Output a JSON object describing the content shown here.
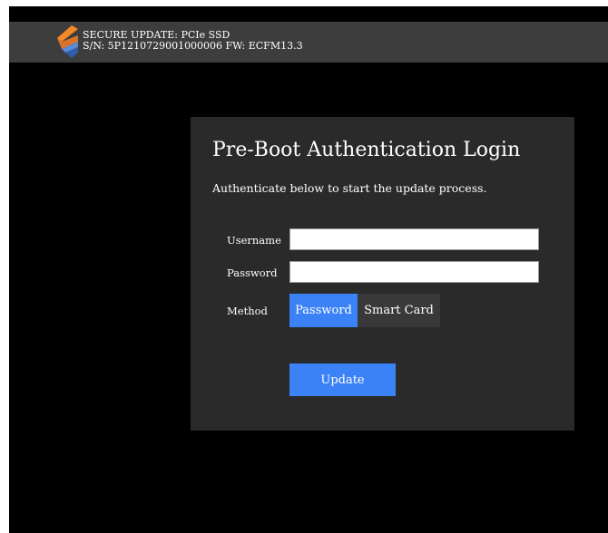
{
  "header": {
    "title_line": "SECURE UPDATE: PCIe SSD",
    "info_line": "S/N: 5P1210729001000006 FW: ECFM13.3",
    "logo_icon": "chevron-logo-icon"
  },
  "login": {
    "title": "Pre-Boot Authentication Login",
    "subtitle": "Authenticate below to start the update process.",
    "username_label": "Username",
    "username_value": "",
    "password_label": "Password",
    "password_value": "",
    "method_label": "Method",
    "methods": [
      {
        "label": "Password",
        "selected": true
      },
      {
        "label": "Smart Card",
        "selected": false
      }
    ],
    "update_label": "Update"
  },
  "colors": {
    "accent": "#3b82f6",
    "panel": "#2b2a2b",
    "topbar": "#3d3d3d",
    "logo_orange": "#f4892a",
    "logo_blue": "#2f5ea8"
  }
}
